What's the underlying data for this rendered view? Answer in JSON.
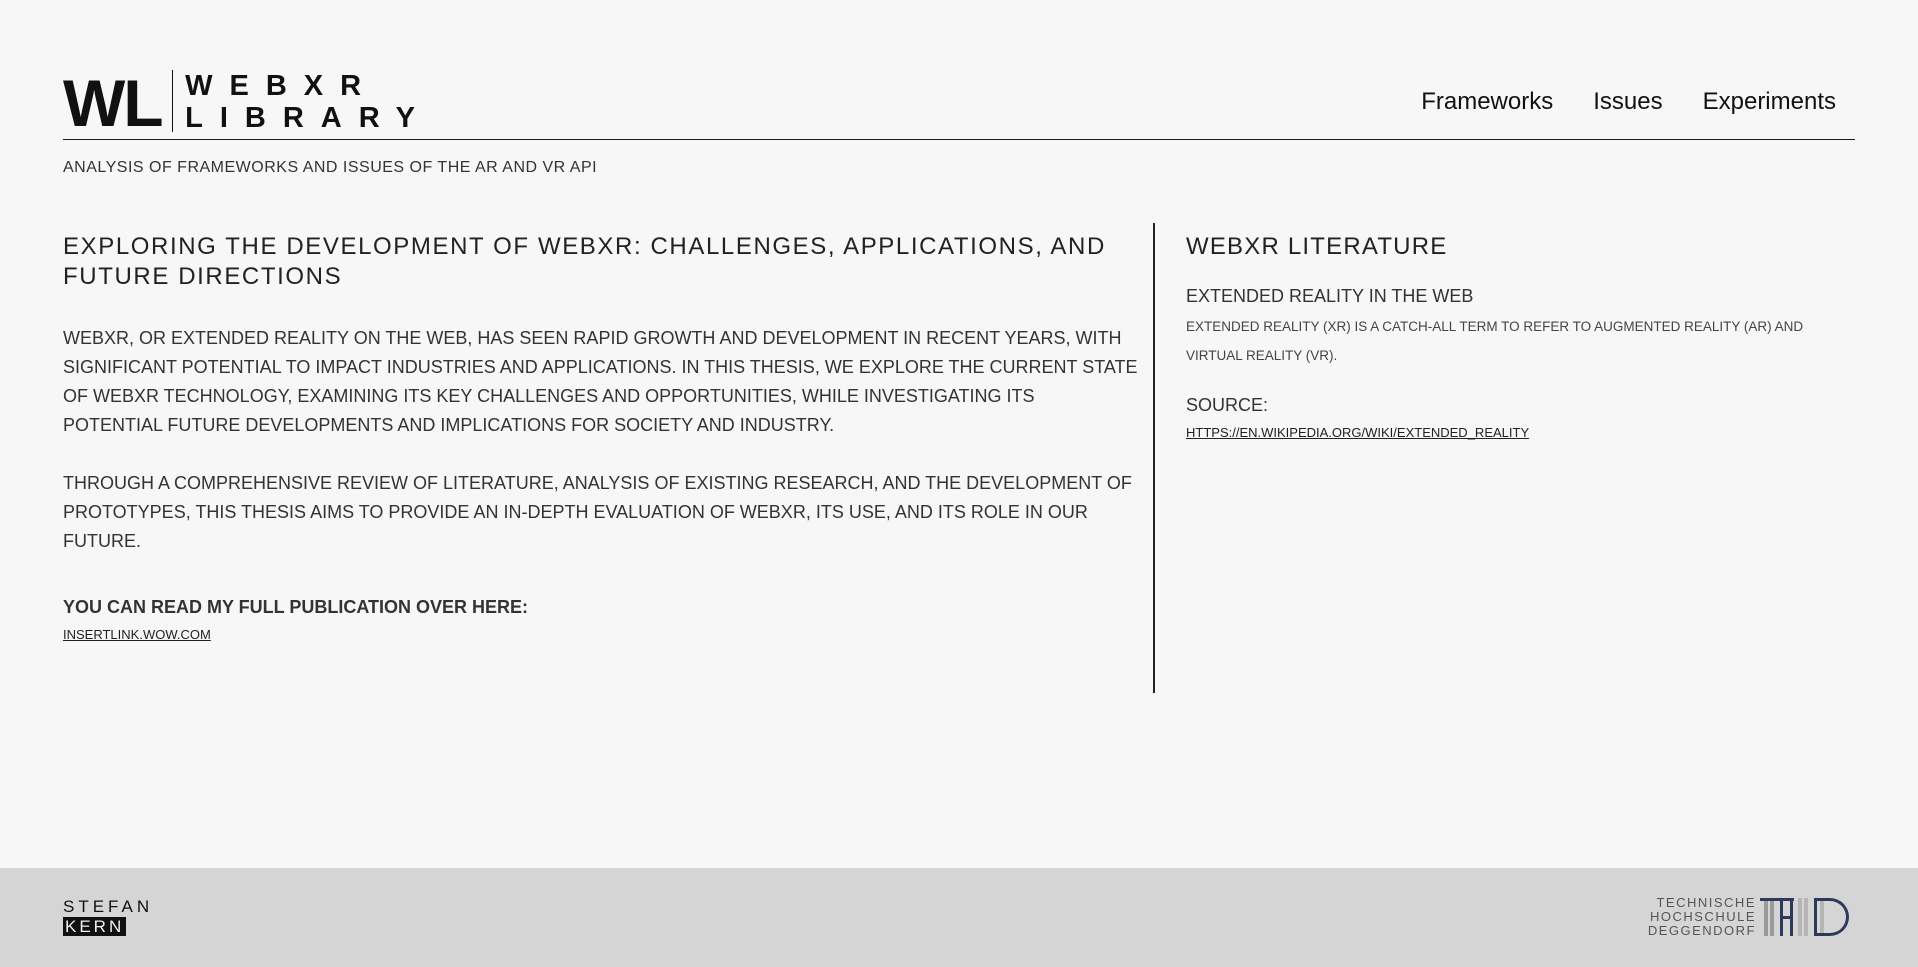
{
  "header": {
    "logo_mark": "WL",
    "logo_word_1": "WEBXR",
    "logo_word_2": "LIBRARY",
    "nav": [
      "Frameworks",
      "Issues",
      "Experiments"
    ]
  },
  "tagline": "ANALYSIS OF FRAMEWORKS AND ISSUES OF THE AR AND VR API",
  "main": {
    "title": "EXPLORING THE DEVELOPMENT OF WEBXR: CHALLENGES, APPLICATIONS, AND FUTURE DIRECTIONS",
    "paragraph_1": "WEBXR, OR EXTENDED REALITY ON THE WEB, HAS SEEN RAPID GROWTH AND DEVELOPMENT IN RECENT YEARS, WITH SIGNIFICANT POTENTIAL TO IMPACT INDUSTRIES AND APPLICATIONS. IN THIS THESIS, WE EXPLORE THE CURRENT STATE OF WEBXR TECHNOLOGY, EXAMINING ITS KEY CHALLENGES AND OPPORTUNITIES, WHILE INVESTIGATING ITS POTENTIAL FUTURE DEVELOPMENTS AND IMPLICATIONS FOR SOCIETY AND INDUSTRY.",
    "paragraph_2": "THROUGH A COMPREHENSIVE REVIEW OF LITERATURE, ANALYSIS OF EXISTING RESEARCH, AND THE DEVELOPMENT OF PROTOTYPES, THIS THESIS AIMS TO PROVIDE AN IN-DEPTH EVALUATION OF WEBXR, ITS USE, AND ITS ROLE IN OUR FUTURE.",
    "read_label": "YOU CAN READ MY FULL PUBLICATION OVER HERE:",
    "read_link": "INSERTLINK.WOW.COM"
  },
  "sidebar": {
    "title": "WEBXR LITERATURE",
    "subtitle": "EXTENDED REALITY IN THE WEB",
    "text": "EXTENDED REALITY (XR) IS A CATCH-ALL TERM TO REFER TO AUGMENTED REALITY (AR) AND VIRTUAL REALITY (VR).",
    "source_label": "SOURCE:",
    "source_link": "HTTPS://EN.WIKIPEDIA.ORG/WIKI/EXTENDED_REALITY"
  },
  "footer": {
    "author_first": "STEFAN",
    "author_last": "KERN",
    "institution_lines": [
      "TECHNISCHE",
      "HOCHSCHULE",
      "DEGGENDORF"
    ],
    "institution_logo": "THD"
  },
  "colors": {
    "background": "#f7f7f7",
    "footer_background": "#d5d5d5",
    "text": "#2b2b2b",
    "thd_navy": "#2e3a5c"
  }
}
